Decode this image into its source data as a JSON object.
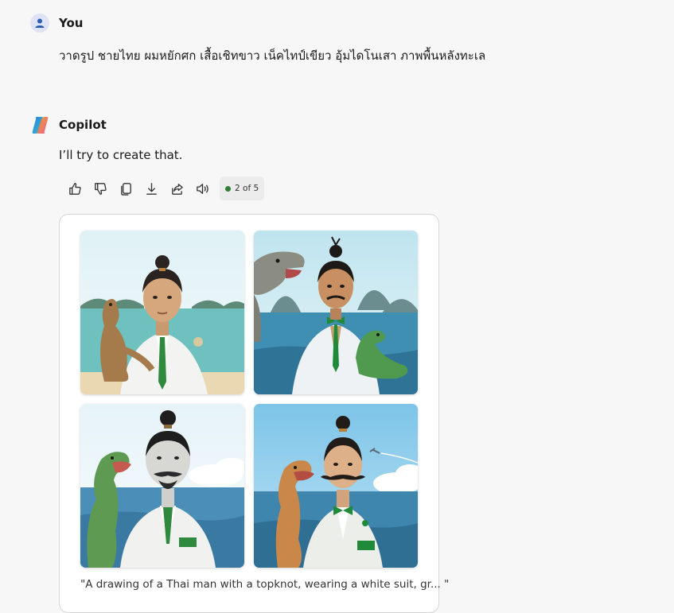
{
  "user_message": {
    "sender": "You",
    "text": "วาดรูป ชายไทย ผมหยักศก เสื้อเชิทขาว เน็คไทป์เขียว อุ้มไดโนเสา ภาพพื้นหลังทะเล"
  },
  "assistant_message": {
    "sender": "Copilot",
    "text": "I’ll try to create that.",
    "counter": "2 of 5"
  },
  "actions": [
    {
      "icon": "thumbs-up-icon"
    },
    {
      "icon": "thumbs-down-icon"
    },
    {
      "icon": "copy-icon"
    },
    {
      "icon": "download-icon"
    },
    {
      "icon": "share-icon"
    },
    {
      "icon": "read-aloud-icon"
    }
  ],
  "images": {
    "caption": "\"A drawing of a Thai man with a topknot, wearing a white suit, gr... \""
  },
  "colors": {
    "background": "#f7f7f7",
    "status_dot": "#2e7d32",
    "tie_green": "#1f8a3a",
    "sea": "#3f8fb3"
  }
}
